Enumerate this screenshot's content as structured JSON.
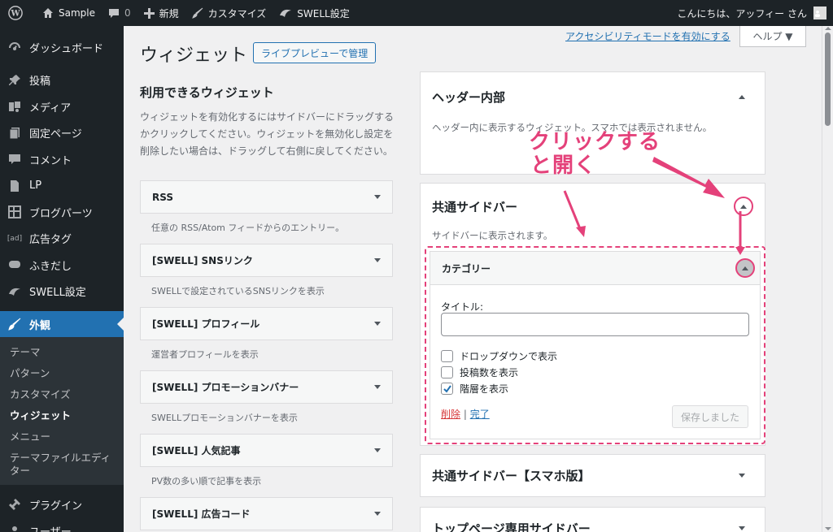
{
  "adminbar": {
    "site_name": "Sample",
    "comments_count": "0",
    "new_label": "新規",
    "customize_label": "カスタマイズ",
    "swell_label": "SWELL設定",
    "greeting": "こんにちは、アッフィー さん"
  },
  "sidebar": {
    "items": [
      {
        "label": "ダッシュボード",
        "icon": "dashboard-icon"
      },
      {
        "label": "投稿",
        "icon": "pin-icon"
      },
      {
        "label": "メディア",
        "icon": "media-icon"
      },
      {
        "label": "固定ページ",
        "icon": "page-icon"
      },
      {
        "label": "コメント",
        "icon": "comment-icon"
      },
      {
        "label": "LP",
        "icon": "document-icon"
      },
      {
        "label": "ブログパーツ",
        "icon": "grid-icon"
      },
      {
        "label": "広告タグ",
        "icon": "ad-icon"
      },
      {
        "label": "ふきだし",
        "icon": "bubble-icon"
      },
      {
        "label": "SWELL設定",
        "icon": "swell-icon"
      }
    ],
    "active": {
      "label": "外観",
      "icon": "brush-icon"
    },
    "submenu": [
      "テーマ",
      "パターン",
      "カスタマイズ",
      "ウィジェット",
      "メニュー",
      "テーマファイルエディター"
    ],
    "submenu_current": "ウィジェット",
    "after": [
      {
        "label": "プラグイン",
        "icon": "plugin-icon"
      },
      {
        "label": "ユーザー",
        "icon": "user-icon"
      }
    ]
  },
  "header": {
    "title": "ウィジェット",
    "preview_button": "ライブプレビューで管理",
    "a11y_link": "アクセシビリティモードを有効にする",
    "help_tab": "ヘルプ ▼"
  },
  "available": {
    "title": "利用できるウィジェット",
    "description": "ウィジェットを有効化するにはサイドバーにドラッグするかクリックしてください。ウィジェットを無効化し設定を削除したい場合は、ドラッグして右側に戻してください。",
    "widgets": [
      {
        "name": "RSS",
        "desc": "任意の RSS/Atom フィードからのエントリー。"
      },
      {
        "name": "[SWELL] SNSリンク",
        "desc": "SWELLで設定されているSNSリンクを表示"
      },
      {
        "name": "[SWELL] プロフィール",
        "desc": "運営者プロフィールを表示"
      },
      {
        "name": "[SWELL] プロモーションバナー",
        "desc": "SWELLプロモーションバナーを表示"
      },
      {
        "name": "[SWELL] 人気記事",
        "desc": "PV数の多い順で記事を表示"
      },
      {
        "name": "[SWELL] 広告コード",
        "desc": ""
      }
    ]
  },
  "areas": {
    "header_inner": {
      "title": "ヘッダー内部",
      "desc": "ヘッダー内に表示するウィジェット。スマホでは表示されません。"
    },
    "common_sidebar": {
      "title": "共通サイドバー",
      "desc": "サイドバーに表示されます。"
    },
    "common_sidebar_sp": {
      "title": "共通サイドバー【スマホ版】"
    },
    "top_sidebar": {
      "title": "トップページ専用サイドバー"
    }
  },
  "category_widget": {
    "title": "カテゴリー",
    "field_label": "タイトル:",
    "title_value": "",
    "checkboxes": [
      {
        "label": "ドロップダウンで表示",
        "checked": false
      },
      {
        "label": "投稿数を表示",
        "checked": false
      },
      {
        "label": "階層を表示",
        "checked": true
      }
    ],
    "delete_link": "削除",
    "separator": "|",
    "done_link": "完了",
    "save_button": "保存しました"
  },
  "annotation": {
    "line1": "クリックする",
    "line2": "と開く",
    "color": "#e4417a"
  }
}
